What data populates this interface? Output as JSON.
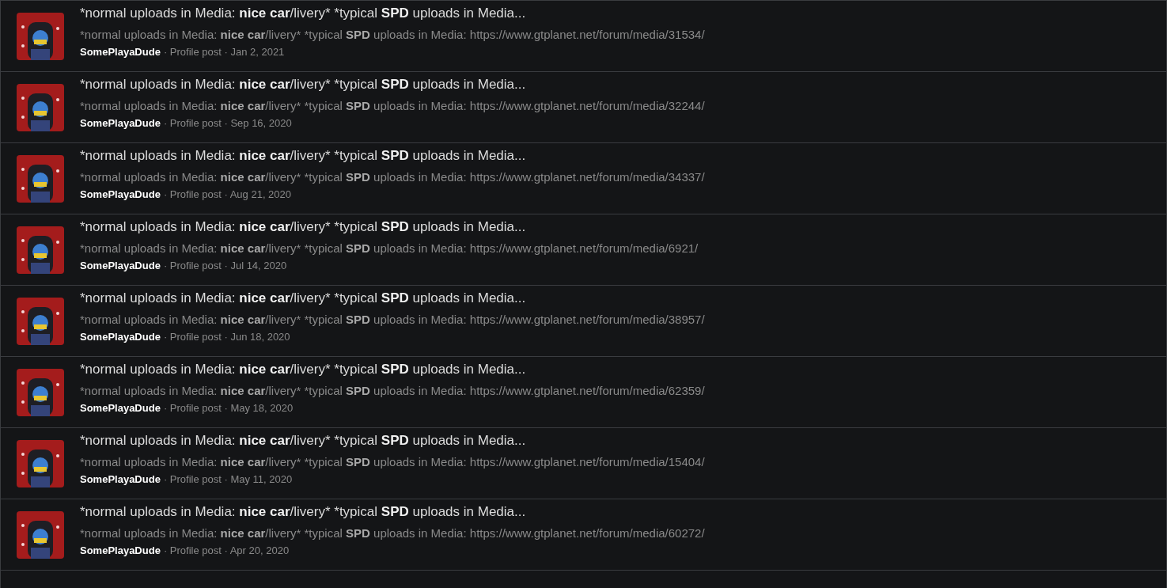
{
  "results": [
    {
      "title": [
        {
          "text": "*normal uploads in Media: ",
          "bold": false
        },
        {
          "text": "nice car",
          "bold": true
        },
        {
          "text": "/livery* *typical ",
          "bold": false
        },
        {
          "text": "SPD",
          "bold": true
        },
        {
          "text": " uploads in Media...",
          "bold": false
        }
      ],
      "snippet": [
        {
          "text": "*normal uploads in Media: ",
          "bold": false
        },
        {
          "text": "nice car",
          "bold": true
        },
        {
          "text": "/livery* *typical ",
          "bold": false
        },
        {
          "text": "SPD",
          "bold": true
        },
        {
          "text": " uploads in Media: https://www.gtplanet.net/forum/media/31534/",
          "bold": false
        }
      ],
      "author": "SomePlayaDude",
      "meta": "· Profile post · Jan 2, 2021"
    },
    {
      "title": [
        {
          "text": "*normal uploads in Media: ",
          "bold": false
        },
        {
          "text": "nice car",
          "bold": true
        },
        {
          "text": "/livery* *typical ",
          "bold": false
        },
        {
          "text": "SPD",
          "bold": true
        },
        {
          "text": " uploads in Media...",
          "bold": false
        }
      ],
      "snippet": [
        {
          "text": "*normal uploads in Media: ",
          "bold": false
        },
        {
          "text": "nice car",
          "bold": true
        },
        {
          "text": "/livery* *typical ",
          "bold": false
        },
        {
          "text": "SPD",
          "bold": true
        },
        {
          "text": " uploads in Media: https://www.gtplanet.net/forum/media/32244/",
          "bold": false
        }
      ],
      "author": "SomePlayaDude",
      "meta": "· Profile post · Sep 16, 2020"
    },
    {
      "title": [
        {
          "text": "*normal uploads in Media: ",
          "bold": false
        },
        {
          "text": "nice car",
          "bold": true
        },
        {
          "text": "/livery* *typical ",
          "bold": false
        },
        {
          "text": "SPD",
          "bold": true
        },
        {
          "text": " uploads in Media...",
          "bold": false
        }
      ],
      "snippet": [
        {
          "text": "*normal uploads in Media: ",
          "bold": false
        },
        {
          "text": "nice car",
          "bold": true
        },
        {
          "text": "/livery* *typical ",
          "bold": false
        },
        {
          "text": "SPD",
          "bold": true
        },
        {
          "text": " uploads in Media: https://www.gtplanet.net/forum/media/34337/",
          "bold": false
        }
      ],
      "author": "SomePlayaDude",
      "meta": "· Profile post · Aug 21, 2020"
    },
    {
      "title": [
        {
          "text": "*normal uploads in Media: ",
          "bold": false
        },
        {
          "text": "nice car",
          "bold": true
        },
        {
          "text": "/livery* *typical ",
          "bold": false
        },
        {
          "text": "SPD",
          "bold": true
        },
        {
          "text": " uploads in Media...",
          "bold": false
        }
      ],
      "snippet": [
        {
          "text": "*normal uploads in Media: ",
          "bold": false
        },
        {
          "text": "nice car",
          "bold": true
        },
        {
          "text": "/livery* *typical ",
          "bold": false
        },
        {
          "text": "SPD",
          "bold": true
        },
        {
          "text": " uploads in Media: https://www.gtplanet.net/forum/media/6921/",
          "bold": false
        }
      ],
      "author": "SomePlayaDude",
      "meta": "· Profile post · Jul 14, 2020"
    },
    {
      "title": [
        {
          "text": "*normal uploads in Media: ",
          "bold": false
        },
        {
          "text": "nice car",
          "bold": true
        },
        {
          "text": "/livery* *typical ",
          "bold": false
        },
        {
          "text": "SPD",
          "bold": true
        },
        {
          "text": " uploads in Media...",
          "bold": false
        }
      ],
      "snippet": [
        {
          "text": "*normal uploads in Media: ",
          "bold": false
        },
        {
          "text": "nice car",
          "bold": true
        },
        {
          "text": "/livery* *typical ",
          "bold": false
        },
        {
          "text": "SPD",
          "bold": true
        },
        {
          "text": " uploads in Media: https://www.gtplanet.net/forum/media/38957/",
          "bold": false
        }
      ],
      "author": "SomePlayaDude",
      "meta": "· Profile post · Jun 18, 2020"
    },
    {
      "title": [
        {
          "text": "*normal uploads in Media: ",
          "bold": false
        },
        {
          "text": "nice car",
          "bold": true
        },
        {
          "text": "/livery* *typical ",
          "bold": false
        },
        {
          "text": "SPD",
          "bold": true
        },
        {
          "text": " uploads in Media...",
          "bold": false
        }
      ],
      "snippet": [
        {
          "text": "*normal uploads in Media: ",
          "bold": false
        },
        {
          "text": "nice car",
          "bold": true
        },
        {
          "text": "/livery* *typical ",
          "bold": false
        },
        {
          "text": "SPD",
          "bold": true
        },
        {
          "text": " uploads in Media: https://www.gtplanet.net/forum/media/62359/",
          "bold": false
        }
      ],
      "author": "SomePlayaDude",
      "meta": "· Profile post · May 18, 2020"
    },
    {
      "title": [
        {
          "text": "*normal uploads in Media: ",
          "bold": false
        },
        {
          "text": "nice car",
          "bold": true
        },
        {
          "text": "/livery* *typical ",
          "bold": false
        },
        {
          "text": "SPD",
          "bold": true
        },
        {
          "text": " uploads in Media...",
          "bold": false
        }
      ],
      "snippet": [
        {
          "text": "*normal uploads in Media: ",
          "bold": false
        },
        {
          "text": "nice car",
          "bold": true
        },
        {
          "text": "/livery* *typical ",
          "bold": false
        },
        {
          "text": "SPD",
          "bold": true
        },
        {
          "text": " uploads in Media: https://www.gtplanet.net/forum/media/15404/",
          "bold": false
        }
      ],
      "author": "SomePlayaDude",
      "meta": "· Profile post · May 11, 2020"
    },
    {
      "title": [
        {
          "text": "*normal uploads in Media: ",
          "bold": false
        },
        {
          "text": "nice car",
          "bold": true
        },
        {
          "text": "/livery* *typical ",
          "bold": false
        },
        {
          "text": "SPD",
          "bold": true
        },
        {
          "text": " uploads in Media...",
          "bold": false
        }
      ],
      "snippet": [
        {
          "text": "*normal uploads in Media: ",
          "bold": false
        },
        {
          "text": "nice car",
          "bold": true
        },
        {
          "text": "/livery* *typical ",
          "bold": false
        },
        {
          "text": "SPD",
          "bold": true
        },
        {
          "text": " uploads in Media: https://www.gtplanet.net/forum/media/60272/",
          "bold": false
        }
      ],
      "author": "SomePlayaDude",
      "meta": "· Profile post · Apr 20, 2020"
    }
  ]
}
